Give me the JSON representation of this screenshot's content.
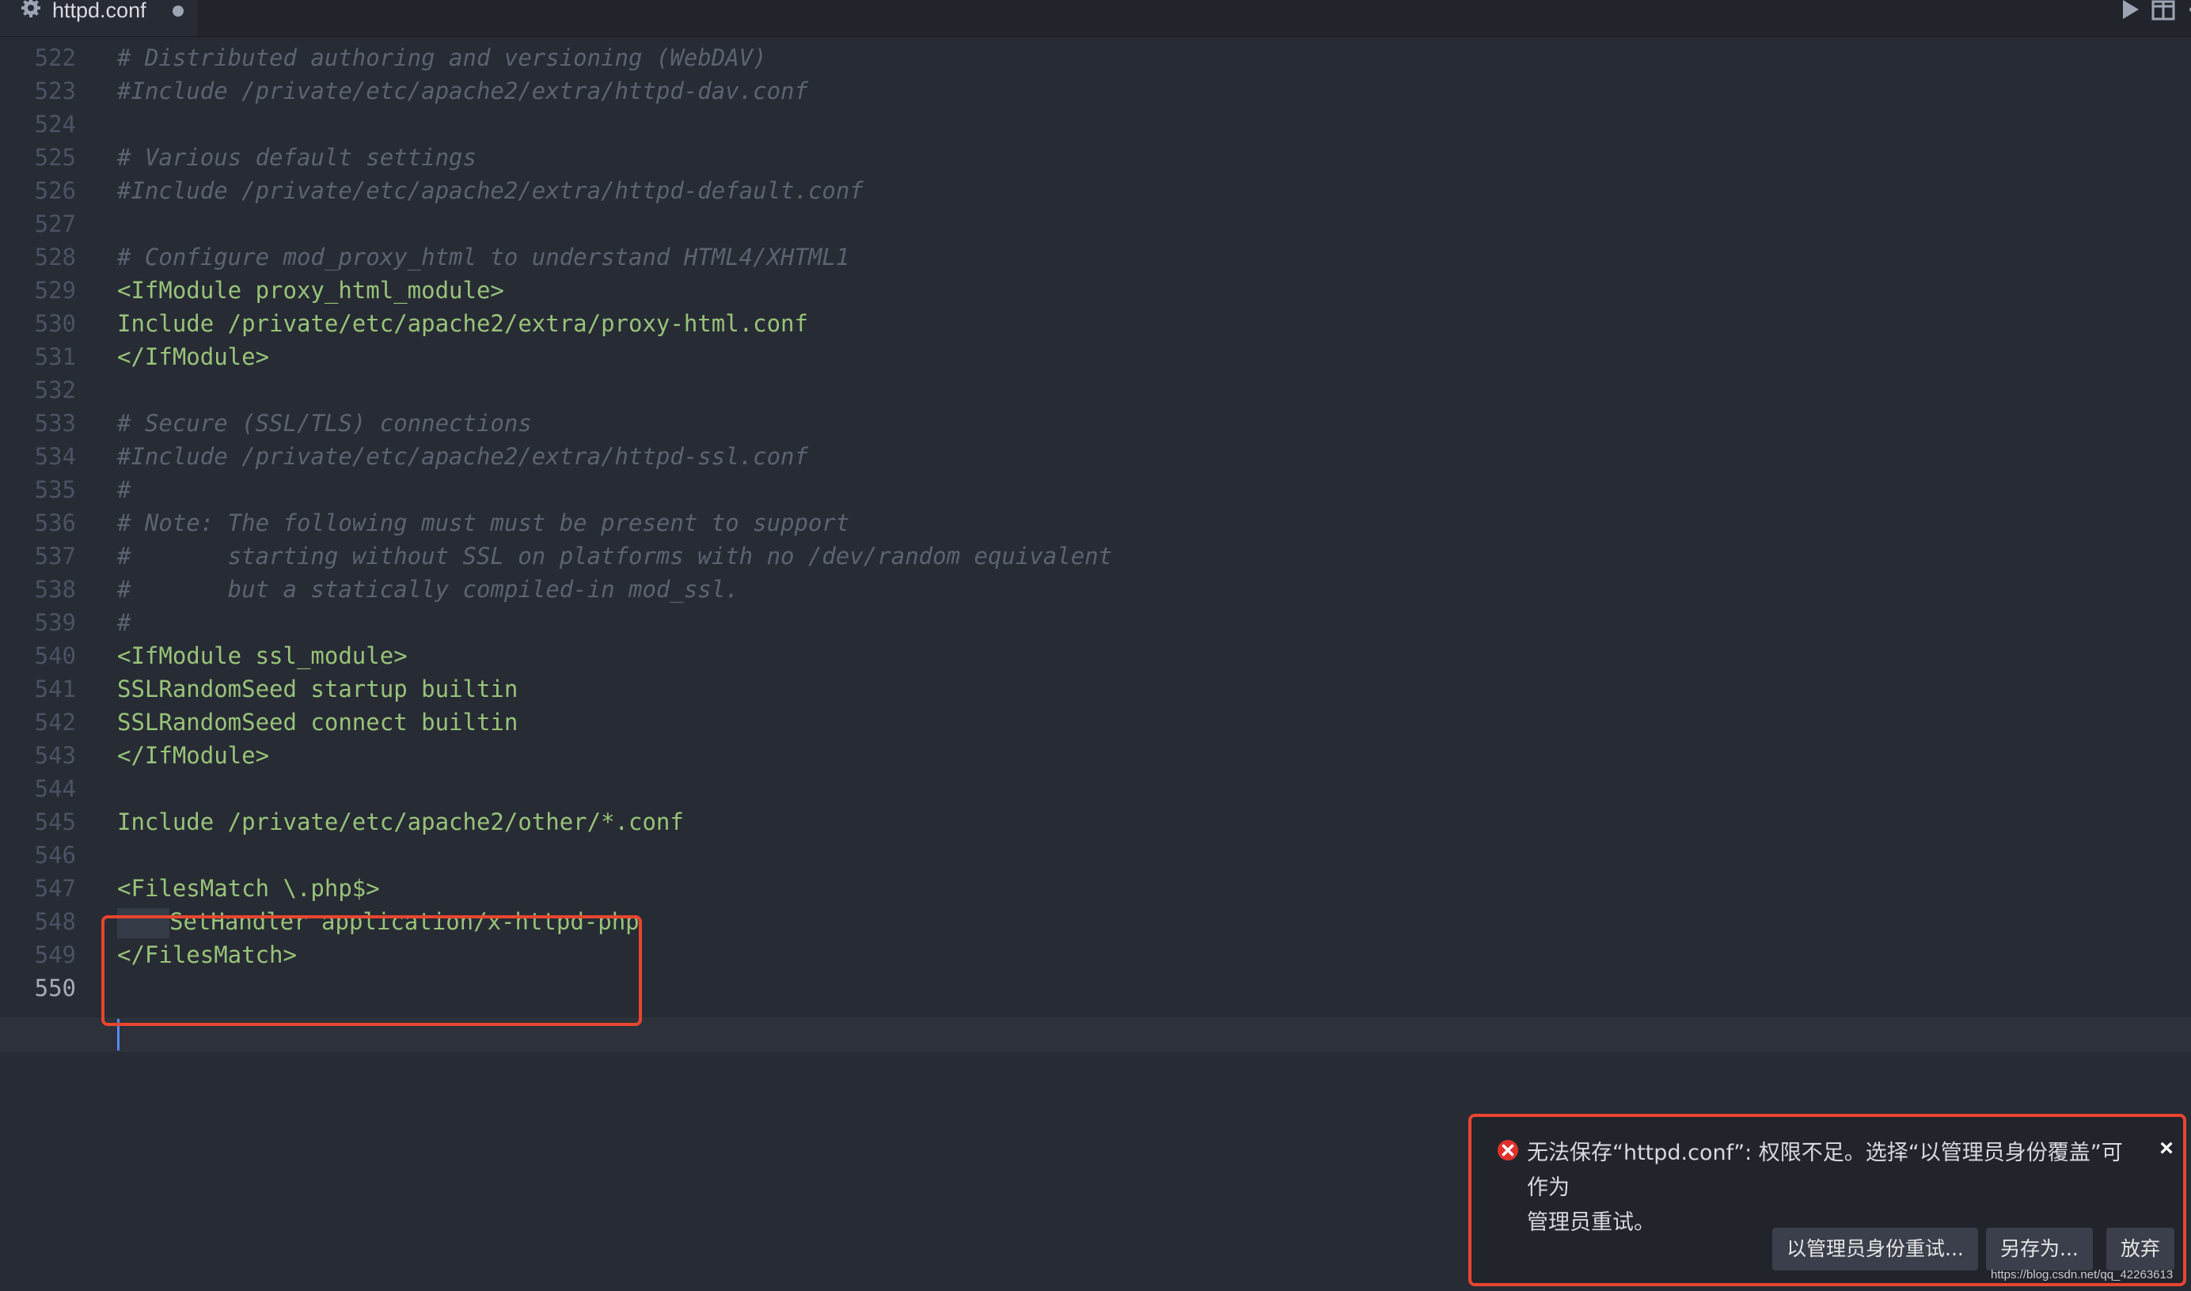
{
  "tab": {
    "title": "httpd.conf"
  },
  "icons": {
    "tab_icon": "gear-icon",
    "dirty_indicator": "modified-dot-icon",
    "run": "play-icon",
    "split": "split-editor-icon",
    "more": "more-icon",
    "error": "error-icon",
    "close": "close-icon"
  },
  "colors": {
    "comment": "#5c6370",
    "string": "#98c379",
    "highlight_border": "#e8452f",
    "cursor": "#528bff"
  },
  "editor": {
    "lines": [
      {
        "num": "522",
        "text": "# Distributed authoring and versioning (WebDAV)",
        "kind": "comment"
      },
      {
        "num": "523",
        "text": "#Include /private/etc/apache2/extra/httpd-dav.conf",
        "kind": "comment"
      },
      {
        "num": "524",
        "text": "",
        "kind": "comment"
      },
      {
        "num": "525",
        "text": "# Various default settings",
        "kind": "comment"
      },
      {
        "num": "526",
        "text": "#Include /private/etc/apache2/extra/httpd-default.conf",
        "kind": "comment"
      },
      {
        "num": "527",
        "text": "",
        "kind": "comment"
      },
      {
        "num": "528",
        "text": "# Configure mod_proxy_html to understand HTML4/XHTML1",
        "kind": "comment"
      },
      {
        "num": "529",
        "text": "<IfModule proxy_html_module>",
        "kind": "str"
      },
      {
        "num": "530",
        "text": "Include /private/etc/apache2/extra/proxy-html.conf",
        "kind": "str"
      },
      {
        "num": "531",
        "text": "</IfModule>",
        "kind": "str"
      },
      {
        "num": "532",
        "text": "",
        "kind": "str"
      },
      {
        "num": "533",
        "text": "# Secure (SSL/TLS) connections",
        "kind": "comment"
      },
      {
        "num": "534",
        "text": "#Include /private/etc/apache2/extra/httpd-ssl.conf",
        "kind": "comment"
      },
      {
        "num": "535",
        "text": "#",
        "kind": "comment"
      },
      {
        "num": "536",
        "text": "# Note: The following must must be present to support",
        "kind": "comment"
      },
      {
        "num": "537",
        "text": "#       starting without SSL on platforms with no /dev/random equivalent",
        "kind": "comment"
      },
      {
        "num": "538",
        "text": "#       but a statically compiled-in mod_ssl.",
        "kind": "comment"
      },
      {
        "num": "539",
        "text": "#",
        "kind": "comment"
      },
      {
        "num": "540",
        "text": "<IfModule ssl_module>",
        "kind": "str"
      },
      {
        "num": "541",
        "text": "SSLRandomSeed startup builtin",
        "kind": "str"
      },
      {
        "num": "542",
        "text": "SSLRandomSeed connect builtin",
        "kind": "str"
      },
      {
        "num": "543",
        "text": "</IfModule>",
        "kind": "str"
      },
      {
        "num": "544",
        "text": "",
        "kind": "str"
      },
      {
        "num": "545",
        "text": "Include /private/etc/apache2/other/*.conf",
        "kind": "str"
      },
      {
        "num": "546",
        "text": "",
        "kind": "str"
      },
      {
        "num": "547",
        "text": "<FilesMatch \\.php$>",
        "kind": "str"
      },
      {
        "num": "548",
        "text": "SetHandler application/x-httpd-php",
        "kind": "str",
        "indent": true
      },
      {
        "num": "549",
        "text": "</FilesMatch>",
        "kind": "str"
      },
      {
        "num": "550",
        "text": "",
        "kind": "str",
        "active": true
      }
    ]
  },
  "notification": {
    "message_line1": "无法保存“httpd.conf”: 权限不足。选择“以管理员身份覆盖”可作为",
    "message_line2": "管理员重试。",
    "buttons": {
      "retry_as_admin": "以管理员身份重试...",
      "save_as": "另存为...",
      "discard": "放弃"
    }
  },
  "watermark": "https://blog.csdn.net/qq_42263613"
}
